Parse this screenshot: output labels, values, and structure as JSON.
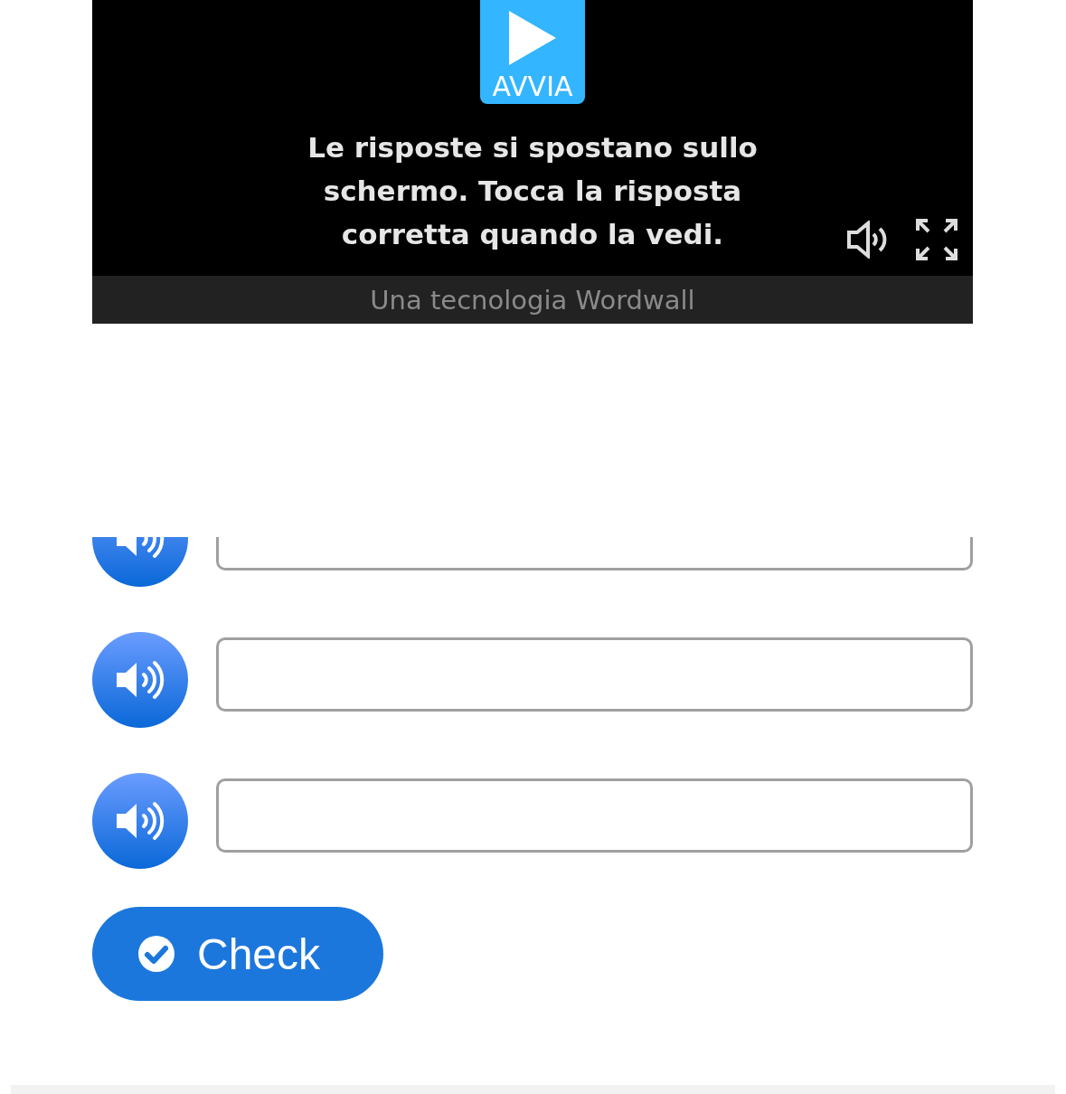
{
  "game": {
    "start_button": "AVVIA",
    "instructions": "Le risposte si spostano sullo schermo. Tocca la risposta corretta quando la vedi.",
    "footer": "Una tecnologia Wordwall"
  },
  "answer_rows": [
    {
      "kind": "audio-input"
    },
    {
      "kind": "audio-input"
    },
    {
      "kind": "audio-input"
    }
  ],
  "check_button": {
    "label": "Check"
  }
}
